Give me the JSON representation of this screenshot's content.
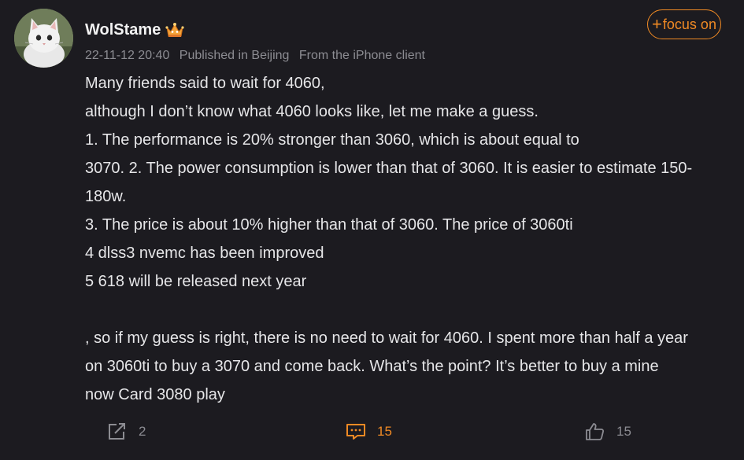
{
  "user": {
    "name": "WolStame",
    "avatar_icon": "cat-avatar",
    "badge_icon": "crown-icon"
  },
  "meta": {
    "datetime": "22-11-12 20:40",
    "location": "Published in Beijing",
    "client": "From the iPhone client"
  },
  "follow": {
    "label": "focus on",
    "accent": "#f08a24"
  },
  "post": {
    "lines": [
      "Many friends said to wait for 4060,",
      "although I don’t know what 4060 looks like, let me make a guess.",
      "1. The performance is 20% stronger than 3060, which is about equal to",
      "3070. 2. The power consumption is lower than that of 3060. It is easier to estimate 150-",
      "180w.",
      "3. The price is about 10% higher than that of 3060. The price of 3060ti",
      "4 dlss3 nvemc has been improved",
      "5 618 will be released next year",
      "",
      ", so if my guess is right, there is no need to wait for 4060. I spent more than half a year",
      "on 3060ti to buy a 3070 and come back. What’s the point? It’s better to buy a mine",
      "now Card 3080 play"
    ]
  },
  "actions": {
    "share": {
      "icon": "share-icon",
      "count": "2"
    },
    "comment": {
      "icon": "comment-icon",
      "count": "15"
    },
    "like": {
      "icon": "thumbs-up-icon",
      "count": "15"
    }
  }
}
